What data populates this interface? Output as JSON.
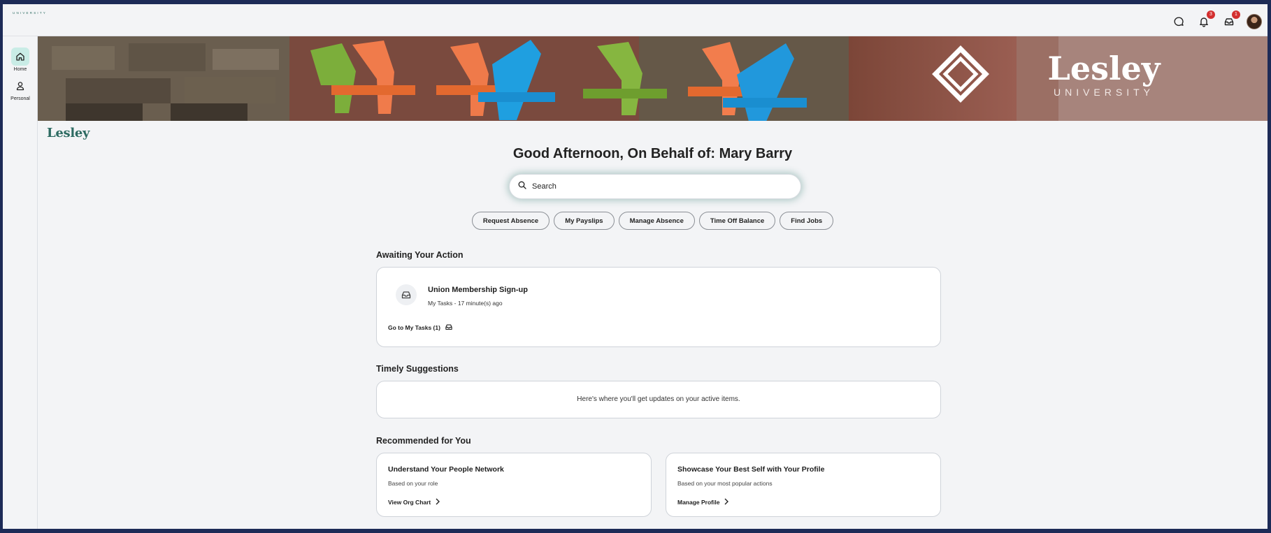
{
  "brand": {
    "logo_text": "Lesley",
    "logo_sub": "UNIVERSITY",
    "accent": "#2d6b62"
  },
  "header": {
    "notifications_count": "3",
    "inbox_count": "1",
    "icons": [
      "chat-icon",
      "bell-icon",
      "inbox-icon",
      "avatar"
    ]
  },
  "sidebar": {
    "items": [
      {
        "label": "Home",
        "icon": "home-icon",
        "active": true
      },
      {
        "label": "Personal",
        "icon": "person-icon",
        "active": false
      }
    ]
  },
  "banner": {
    "logo_text": "Lesley",
    "logo_sub": "UNIVERSITY"
  },
  "main": {
    "greeting": "Good Afternoon, On Behalf of: Mary Barry",
    "search_placeholder": "Search",
    "quick_actions": [
      "Request Absence",
      "My Payslips",
      "Manage Absence",
      "Time Off Balance",
      "Find Jobs"
    ],
    "awaiting": {
      "title": "Awaiting Your Action",
      "task_title": "Union Membership Sign-up",
      "task_sub": "My Tasks - 17 minute(s) ago",
      "link": "Go to My Tasks (1)"
    },
    "timely": {
      "title": "Timely Suggestions",
      "message": "Here's where you'll get updates on your active items."
    },
    "recommended": {
      "title": "Recommended for You",
      "cards": [
        {
          "title": "Understand Your People Network",
          "sub": "Based on your role",
          "link": "View Org Chart"
        },
        {
          "title": "Showcase Your Best Self with Your Profile",
          "sub": "Based on your most popular actions",
          "link": "Manage Profile"
        }
      ]
    }
  }
}
